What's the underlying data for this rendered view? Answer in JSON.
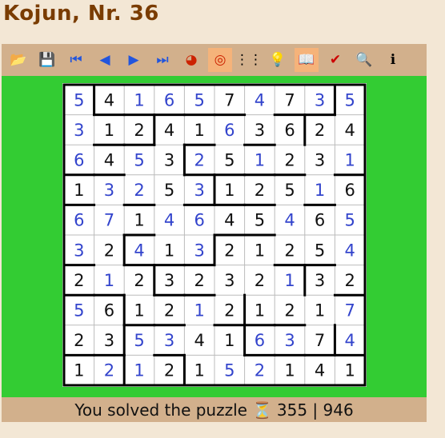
{
  "title": "Kojun, Nr. 36",
  "toolbar": [
    {
      "name": "open-folder-icon",
      "glyph": "📂",
      "active": false
    },
    {
      "name": "save-icon",
      "glyph": "💾",
      "active": false
    },
    {
      "name": "first-icon",
      "glyph": "⏮",
      "active": false
    },
    {
      "name": "previous-icon",
      "glyph": "◀",
      "active": false
    },
    {
      "name": "next-icon",
      "glyph": "▶",
      "active": false
    },
    {
      "name": "last-icon",
      "glyph": "⏭",
      "active": false
    },
    {
      "name": "color-wheel-icon",
      "glyph": "◕",
      "active": false
    },
    {
      "name": "target-icon",
      "glyph": "◎",
      "active": true
    },
    {
      "name": "grid-dots-icon",
      "glyph": "⋮⋮",
      "active": false
    },
    {
      "name": "hint-bulb-icon",
      "glyph": "💡",
      "active": false
    },
    {
      "name": "book-icon",
      "glyph": "📖",
      "active": true
    },
    {
      "name": "check-icon",
      "glyph": "✔",
      "active": false
    },
    {
      "name": "zoom-icon",
      "glyph": "🔍",
      "active": false
    },
    {
      "name": "info-icon",
      "glyph": "ℹ",
      "active": false
    }
  ],
  "colors": {
    "given": "#111111",
    "solved": "#3344cc",
    "background": "#33cc33",
    "frame": "#d2b08c",
    "title": "#7a3c00"
  },
  "grid": {
    "rows": [
      [
        5,
        4,
        1,
        6,
        5,
        7,
        4,
        7,
        3,
        5
      ],
      [
        3,
        1,
        2,
        4,
        1,
        6,
        3,
        6,
        2,
        4
      ],
      [
        6,
        4,
        5,
        3,
        2,
        5,
        1,
        2,
        3,
        1
      ],
      [
        1,
        3,
        2,
        5,
        3,
        1,
        2,
        5,
        1,
        6
      ],
      [
        6,
        7,
        1,
        4,
        6,
        4,
        5,
        4,
        6,
        5
      ],
      [
        3,
        2,
        4,
        1,
        3,
        2,
        1,
        2,
        5,
        4
      ],
      [
        2,
        1,
        2,
        3,
        2,
        3,
        2,
        1,
        3,
        2
      ],
      [
        5,
        6,
        1,
        2,
        1,
        2,
        1,
        2,
        1,
        7
      ],
      [
        2,
        3,
        5,
        3,
        4,
        1,
        6,
        3,
        7,
        4
      ],
      [
        1,
        2,
        1,
        2,
        1,
        5,
        2,
        1,
        4,
        1
      ]
    ],
    "solved": [
      [
        1,
        0,
        1,
        1,
        1,
        0,
        1,
        0,
        1,
        1
      ],
      [
        1,
        0,
        0,
        0,
        0,
        1,
        0,
        0,
        0,
        0
      ],
      [
        1,
        0,
        1,
        0,
        1,
        0,
        1,
        0,
        0,
        1
      ],
      [
        0,
        1,
        1,
        0,
        1,
        0,
        0,
        0,
        1,
        0
      ],
      [
        1,
        1,
        0,
        1,
        1,
        0,
        0,
        1,
        0,
        1
      ],
      [
        1,
        0,
        1,
        0,
        1,
        0,
        0,
        0,
        0,
        1
      ],
      [
        0,
        1,
        0,
        0,
        0,
        0,
        0,
        1,
        0,
        0
      ],
      [
        1,
        0,
        0,
        0,
        1,
        0,
        0,
        0,
        0,
        1
      ],
      [
        0,
        0,
        1,
        1,
        0,
        0,
        1,
        1,
        0,
        1
      ],
      [
        0,
        1,
        1,
        0,
        0,
        1,
        1,
        0,
        0,
        0
      ]
    ],
    "region_walls_right": [
      [
        1,
        0,
        0,
        0,
        0,
        0,
        0,
        0,
        1
      ],
      [
        0,
        0,
        1,
        0,
        0,
        0,
        0,
        1,
        0
      ],
      [
        0,
        0,
        0,
        1,
        0,
        0,
        0,
        0,
        0
      ],
      [
        0,
        0,
        0,
        0,
        1,
        0,
        0,
        0,
        0
      ],
      [
        0,
        0,
        0,
        0,
        0,
        0,
        0,
        0,
        0
      ],
      [
        0,
        1,
        0,
        0,
        1,
        0,
        0,
        0,
        0
      ],
      [
        0,
        0,
        1,
        0,
        0,
        0,
        0,
        1,
        0
      ],
      [
        0,
        1,
        0,
        0,
        0,
        1,
        0,
        0,
        0
      ],
      [
        0,
        1,
        0,
        0,
        0,
        1,
        0,
        0,
        1
      ],
      [
        0,
        1,
        0,
        1,
        0,
        0,
        0,
        0,
        0
      ]
    ],
    "region_walls_bottom": [
      [
        0,
        1,
        1,
        1,
        1,
        1,
        0,
        1,
        1,
        0
      ],
      [
        0,
        1,
        1,
        0,
        1,
        0,
        1,
        0,
        0,
        0
      ],
      [
        1,
        1,
        0,
        0,
        1,
        1,
        1,
        1,
        0,
        1
      ],
      [
        1,
        0,
        1,
        0,
        1,
        1,
        1,
        0,
        1,
        0
      ],
      [
        0,
        0,
        1,
        0,
        0,
        1,
        1,
        0,
        0,
        0
      ],
      [
        1,
        0,
        1,
        1,
        1,
        0,
        0,
        1,
        1,
        0
      ],
      [
        1,
        1,
        0,
        1,
        1,
        0,
        0,
        0,
        0,
        1
      ],
      [
        0,
        0,
        1,
        1,
        0,
        1,
        1,
        1,
        0,
        0
      ],
      [
        1,
        1,
        0,
        1,
        0,
        0,
        1,
        1,
        1,
        1
      ]
    ]
  },
  "status": {
    "message": "You solved the puzzle",
    "hourglass": "⏳",
    "score": "355 | 946"
  }
}
